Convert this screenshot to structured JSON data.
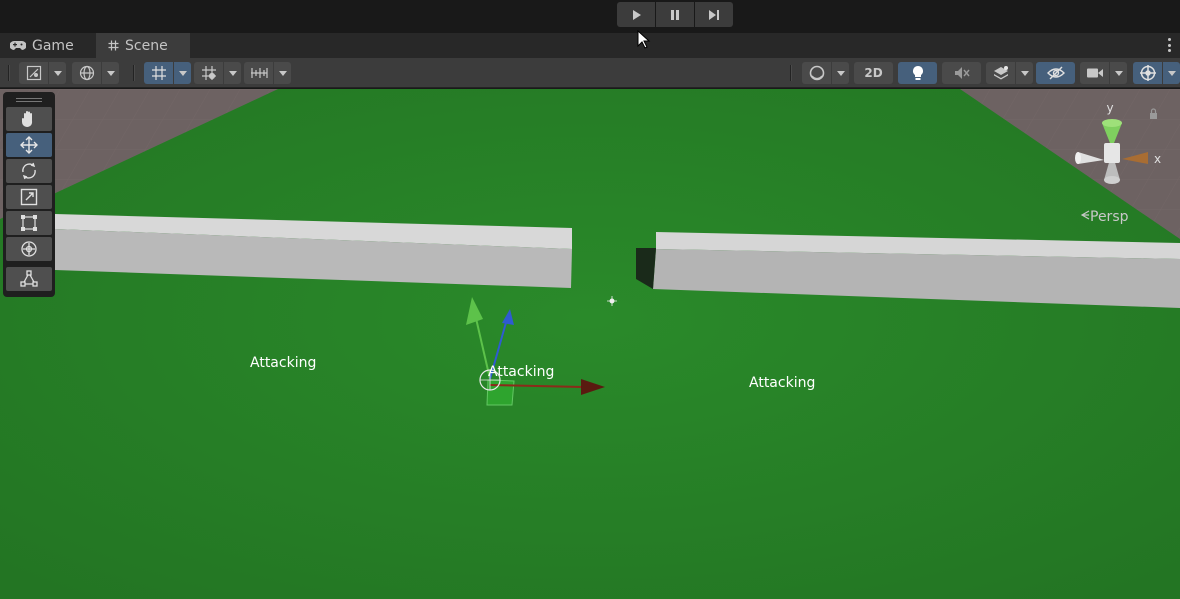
{
  "playbar": {
    "play_label": "Play",
    "pause_label": "Pause",
    "step_label": "Step"
  },
  "tabs": [
    {
      "label": "Game",
      "icon": "gamepad-icon"
    },
    {
      "label": "Scene",
      "icon": "hash-icon"
    }
  ],
  "toolbar": {
    "mode_2d_label": "2D"
  },
  "gizmo": {
    "y_label": "y",
    "x_label": "x",
    "projection_label": "Persp"
  },
  "scene_labels": [
    {
      "text": "Attacking"
    },
    {
      "text": "Attacking"
    },
    {
      "text": "Attacking"
    }
  ],
  "colors": {
    "ground": "#2b7f2b",
    "accent_on": "#46607c",
    "x_axis": "#8b2a1a",
    "y_axis": "#5dc24a",
    "z_axis": "#2f5bd1"
  }
}
